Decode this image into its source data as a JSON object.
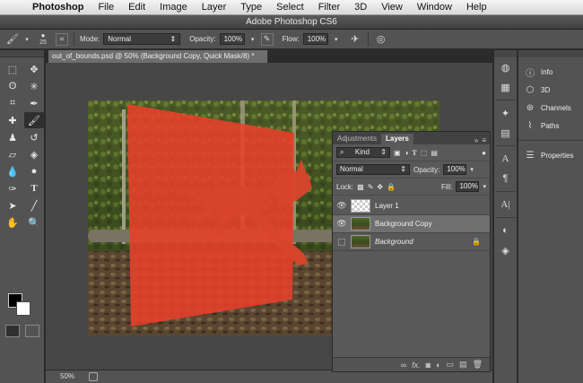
{
  "menubar": {
    "app_name": "Photoshop",
    "items": [
      "File",
      "Edit",
      "Image",
      "Layer",
      "Type",
      "Select",
      "Filter",
      "3D",
      "View",
      "Window",
      "Help"
    ]
  },
  "window_title": "Adobe Photoshop CS6",
  "options_bar": {
    "brush_size": "25",
    "mode_label": "Mode:",
    "mode_value": "Normal",
    "opacity_label": "Opacity:",
    "opacity_value": "100%",
    "flow_label": "Flow:",
    "flow_value": "100%"
  },
  "document": {
    "tab_title": "out_of_bounds.psd @ 50% (Background Copy, Quick Mask/8) *",
    "zoom": "50%"
  },
  "layers_panel": {
    "tabs": [
      "Adjustments",
      "Layers"
    ],
    "active_tab": "Layers",
    "kind_label": "Kind",
    "blend_mode": "Normal",
    "opacity_label": "Opacity:",
    "opacity_value": "100%",
    "lock_label": "Lock:",
    "fill_label": "Fill:",
    "fill_value": "100%",
    "layers": [
      {
        "name": "Layer 1",
        "visible": true,
        "selected": false
      },
      {
        "name": "Background Copy",
        "visible": true,
        "selected": true
      },
      {
        "name": "Background",
        "visible": false,
        "selected": false,
        "locked": true
      }
    ]
  },
  "right_dock": {
    "items": [
      "Info",
      "3D",
      "Channels",
      "Paths",
      "Properties"
    ]
  },
  "colors": {
    "quick_mask": "#e8402a",
    "foreground": "#000000",
    "background": "#ffffff"
  }
}
